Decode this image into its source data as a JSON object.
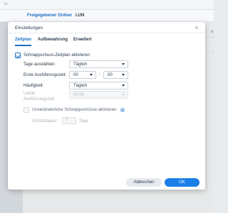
{
  "background": {
    "topbar_text": "ts",
    "tabs": [
      "Freigegebener Ordner",
      "LUN"
    ],
    "edge_text": "le"
  },
  "dialog": {
    "title": "Einstellungen",
    "close_icon": "close-icon",
    "tabs": [
      {
        "label": "Zeitplan",
        "active": true
      },
      {
        "label": "Aufbewahrung",
        "active": false
      },
      {
        "label": "Erweitert",
        "active": false
      }
    ],
    "enable_schedule": {
      "label": "Schnappschuss-Zeitplan aktivieren",
      "checked": true
    },
    "select_days": {
      "label": "Tage auswählen:",
      "value": "Täglich"
    },
    "first_run": {
      "label": "Erste Ausführungszeit:",
      "hour": "00",
      "minute": "00",
      "separator": ":"
    },
    "frequency": {
      "label": "Häufigkeit:",
      "value": "Täglich"
    },
    "last_run": {
      "label_line1": "Letzte",
      "label_line2": "Ausführungszeit:",
      "value": "00:00"
    },
    "immutable": {
      "label": "Unveränderliche Schnappschüsse aktivieren",
      "checked": false,
      "info_icon": "info-icon",
      "info_glyph": "i"
    },
    "protection": {
      "label": "Schutzdauer:",
      "value": "7",
      "unit": "Tage"
    },
    "buttons": {
      "cancel": "Abbrechen",
      "ok": "OK"
    }
  },
  "colors": {
    "accent": "#1a6fc4",
    "ok_button": "#1a7ee6"
  }
}
